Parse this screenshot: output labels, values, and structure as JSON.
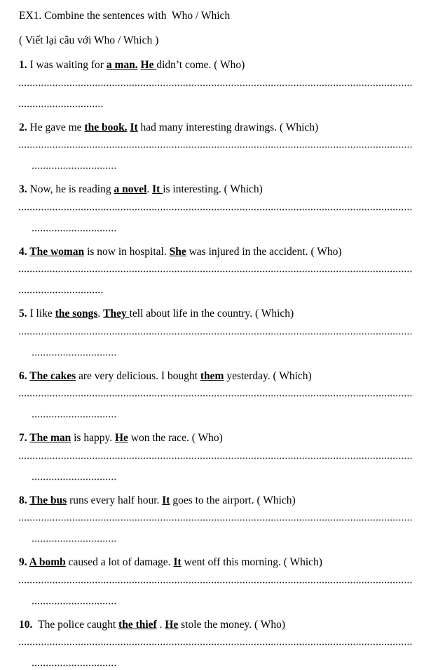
{
  "document": {
    "heading": "EX1. Combine the sentences with  Who / Which",
    "subheading": "( Viết lại câu với Who / Which )",
    "answer_line": {
      "style": "dotted",
      "long_label": "",
      "stub_label": ""
    },
    "exercises": [
      {
        "number": "1.",
        "number_gap": " ",
        "parts": [
          {
            "text": "I was waiting for ",
            "style": "plain"
          },
          {
            "text": "a man.",
            "style": "bold-underline"
          },
          {
            "text": " ",
            "style": "plain"
          },
          {
            "text": "He ",
            "style": "bold-underline"
          },
          {
            "text": "didn’t come. ( Who)",
            "style": "plain"
          }
        ],
        "cue": "Who",
        "stub_indent": false
      },
      {
        "number": "2.",
        "number_gap": " ",
        "parts": [
          {
            "text": "He gave me ",
            "style": "plain"
          },
          {
            "text": "the book.",
            "style": "bold-underline"
          },
          {
            "text": " ",
            "style": "plain"
          },
          {
            "text": "It",
            "style": "bold-underline"
          },
          {
            "text": " had many interesting drawings. ( Which)",
            "style": "plain"
          }
        ],
        "cue": "Which",
        "stub_indent": true
      },
      {
        "number": "3.",
        "number_gap": " ",
        "parts": [
          {
            "text": "Now, he is reading ",
            "style": "plain"
          },
          {
            "text": "a novel",
            "style": "bold-underline"
          },
          {
            "text": ". ",
            "style": "plain"
          },
          {
            "text": "It ",
            "style": "bold-underline"
          },
          {
            "text": "is interesting. ( Which)",
            "style": "plain"
          }
        ],
        "cue": "Which",
        "stub_indent": true
      },
      {
        "number": "4.",
        "number_gap": " ",
        "parts": [
          {
            "text": "The woman",
            "style": "bold-underline"
          },
          {
            "text": " is now in hospital. ",
            "style": "plain"
          },
          {
            "text": "She",
            "style": "bold-underline"
          },
          {
            "text": " was injured in the accident. ( Who)",
            "style": "plain"
          }
        ],
        "cue": "Who",
        "stub_indent": false
      },
      {
        "number": "5.",
        "number_gap": " ",
        "parts": [
          {
            "text": "I like ",
            "style": "plain"
          },
          {
            "text": "the songs",
            "style": "bold-underline"
          },
          {
            "text": ". ",
            "style": "plain"
          },
          {
            "text": "They ",
            "style": "bold-underline"
          },
          {
            "text": "tell about life in the country. ( Which)",
            "style": "plain"
          }
        ],
        "cue": "Which",
        "stub_indent": true
      },
      {
        "number": "6.",
        "number_gap": " ",
        "parts": [
          {
            "text": "The cakes",
            "style": "bold-underline"
          },
          {
            "text": " are very delicious. I bought ",
            "style": "plain"
          },
          {
            "text": "them",
            "style": "bold-underline"
          },
          {
            "text": " yesterday. ( Which)",
            "style": "plain"
          }
        ],
        "cue": "Which",
        "stub_indent": true
      },
      {
        "number": "7.",
        "number_gap": " ",
        "parts": [
          {
            "text": "The man",
            "style": "bold-underline"
          },
          {
            "text": " is happy. ",
            "style": "plain"
          },
          {
            "text": "He",
            "style": "bold-underline"
          },
          {
            "text": " won the race. ( Who)",
            "style": "plain"
          }
        ],
        "cue": "Who",
        "stub_indent": true
      },
      {
        "number": "8.",
        "number_gap": " ",
        "parts": [
          {
            "text": "The bus",
            "style": "bold-underline"
          },
          {
            "text": " runs every half hour. ",
            "style": "plain"
          },
          {
            "text": "It",
            "style": "bold-underline"
          },
          {
            "text": " goes to the airport. ( Which)",
            "style": "plain"
          }
        ],
        "cue": "Which",
        "stub_indent": true
      },
      {
        "number": "9.",
        "number_gap": " ",
        "parts": [
          {
            "text": "A bomb",
            "style": "bold-underline"
          },
          {
            "text": " caused a lot of damage. ",
            "style": "plain"
          },
          {
            "text": "It",
            "style": "bold-underline"
          },
          {
            "text": " went off this morning. ( Which)",
            "style": "plain"
          }
        ],
        "cue": "Which",
        "stub_indent": true
      },
      {
        "number": "10.",
        "number_gap": "  ",
        "parts": [
          {
            "text": "The police caught ",
            "style": "plain"
          },
          {
            "text": "the thief",
            "style": "bold-underline"
          },
          {
            "text": " . ",
            "style": "plain"
          },
          {
            "text": "He",
            "style": "bold-underline"
          },
          {
            "text": " stole the money. ( Who)",
            "style": "plain"
          }
        ],
        "cue": "Who",
        "stub_indent": true
      }
    ]
  }
}
